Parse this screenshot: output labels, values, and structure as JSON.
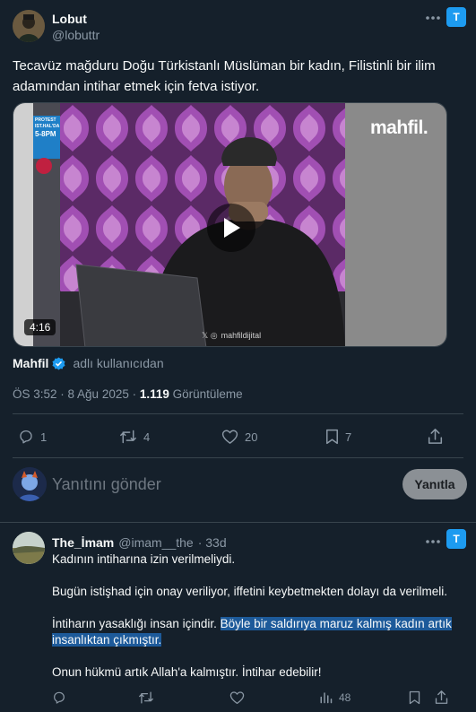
{
  "main_tweet": {
    "author_name": "Lobut",
    "author_handle": "@lobuttr",
    "text": "Tecavüz mağduru Doğu Türkistanlı Müslüman bir kadın, Filistinli bir ilim adamından intihar etmek için fetva istiyor.",
    "video": {
      "duration": "4:16",
      "brand_logo": "mahfil.",
      "watermark": "mahfildijital",
      "poster_lines": [
        "PROTEST",
        "IST.HAL'DA",
        "5-8PM"
      ]
    },
    "source_name": "Mahfil",
    "source_suffix": "adlı kullanıcıdan",
    "timestamp": "ÖS 3:52 · 8 Ağu 2025 · ",
    "views_count": "1.119",
    "views_label": " Görüntüleme",
    "actions": {
      "replies": "1",
      "retweets": "4",
      "likes": "20",
      "bookmarks": "7"
    }
  },
  "composer": {
    "placeholder": "Yanıtını gönder",
    "reply_button": "Yanıtla"
  },
  "reply_tweet": {
    "author_name": "The_İmam",
    "author_handle": "@imam__the",
    "time": "· 33d",
    "paragraphs": {
      "p1": "Kadının intiharına izin verilmeliydi.",
      "p2": "Bugün istişhad için onay veriliyor, iffetini keybetmekten dolayı da verilmeli.",
      "p3_plain": "İntiharın yasaklığı insan içindir. ",
      "p3_selected_1": "Böyle bir saldırıya maruz kalmış kadın artık",
      "p3_selected_2": "insanlıktan çıkmıştır.",
      "p4": "Onun hükmü artık Allah'a kalmıştır. İntihar edebilir!"
    },
    "actions": {
      "views": "48"
    }
  },
  "colors": {
    "background": "#15202b",
    "accent": "#1d9bf0",
    "muted": "#8b98a5",
    "divider": "#38444d",
    "selection": "#1d5a9a"
  },
  "icons": [
    "more-icon",
    "translate-badge-icon",
    "play-icon",
    "verified-icon",
    "reply-icon",
    "retweet-icon",
    "like-icon",
    "bookmark-icon",
    "share-icon",
    "views-icon"
  ]
}
